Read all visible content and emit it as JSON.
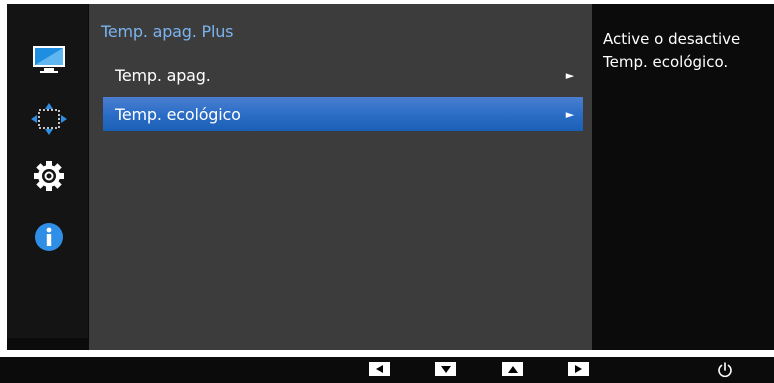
{
  "menu": {
    "title": "Temp. apag. Plus",
    "items": [
      {
        "label": "Temp. apag.",
        "arrow": "►",
        "selected": false
      },
      {
        "label": "Temp. ecológico",
        "arrow": "►",
        "selected": true
      }
    ]
  },
  "help": {
    "text": "Active o desactive Temp. ecológico."
  },
  "sidebar": {
    "icons": [
      "monitor-icon",
      "position-arrows-icon",
      "settings-gear-icon",
      "info-icon"
    ]
  },
  "bottom_bar": {
    "buttons": [
      "left-button",
      "down-button",
      "up-button",
      "right-button",
      "power-button"
    ]
  },
  "colors": {
    "menu_title": "#7ab4ee",
    "selected_item": "#2e6fc8",
    "panel_bg": "#3c3c3c",
    "osd_bg": "#0b0b0b"
  }
}
